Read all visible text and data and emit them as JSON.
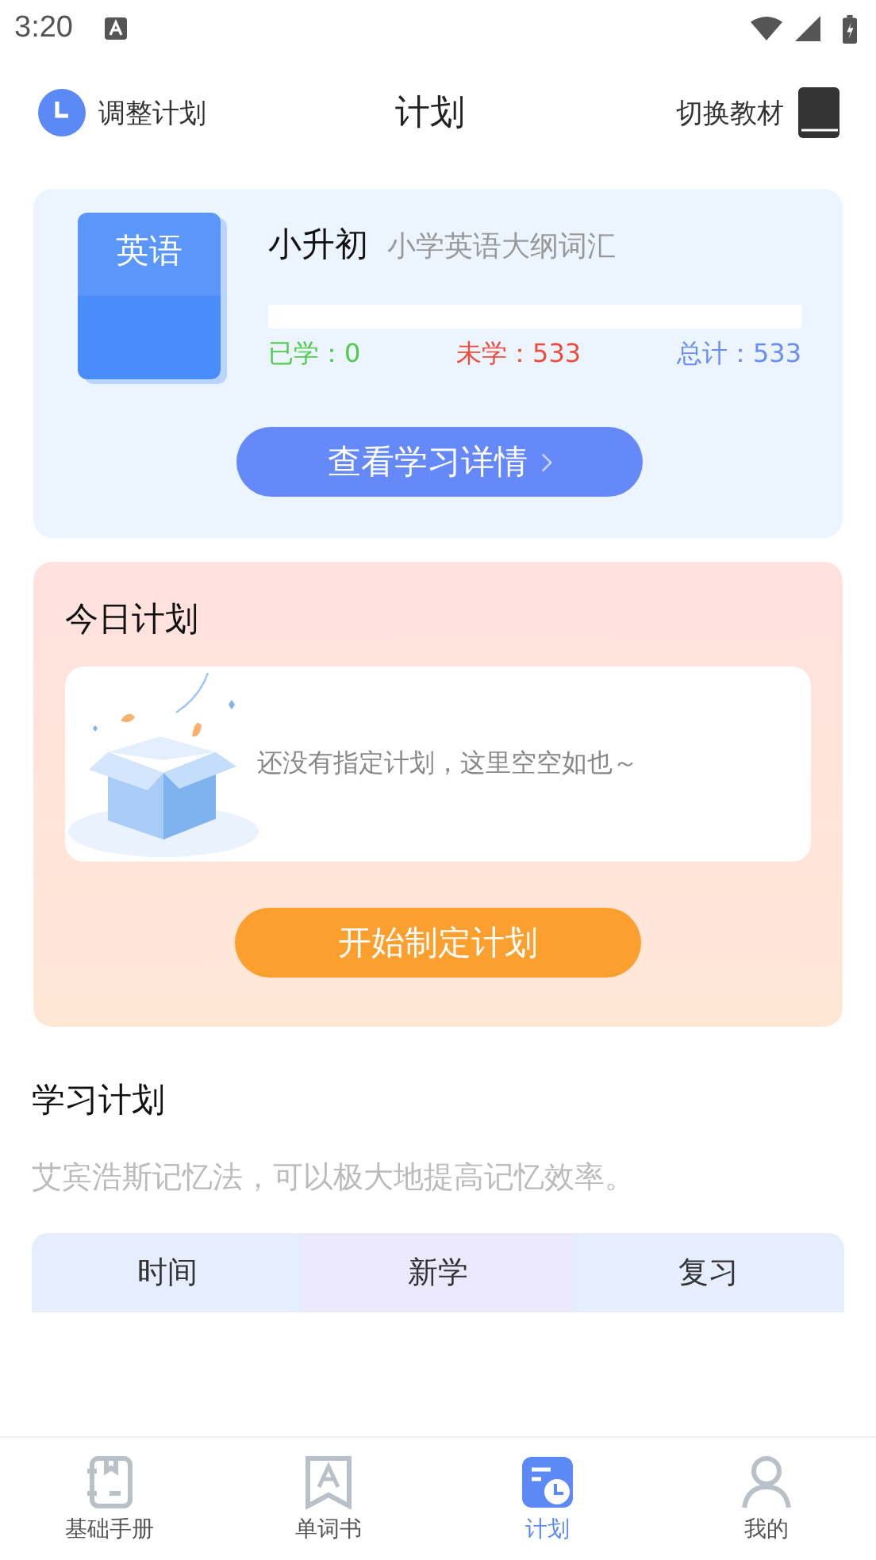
{
  "status_bar": {
    "time": "3:20"
  },
  "header": {
    "left_action": "调整计划",
    "title": "计划",
    "right_action": "切换教材"
  },
  "book_card": {
    "cover_label": "英语",
    "name": "小升初",
    "subtitle": "小学英语大纲词汇",
    "progress": {
      "level": 0
    },
    "stats": [
      {
        "kind": "learned",
        "text": "已学：0"
      },
      {
        "kind": "unlearned",
        "text": "未学：533"
      },
      {
        "kind": "total",
        "text": "总计：533"
      }
    ],
    "button": "查看学习详情"
  },
  "today_plan": {
    "title": "今日计划",
    "empty_text": "还没有指定计划，这里空空如也～",
    "button": "开始制定计划"
  },
  "study_plan": {
    "title": "学习计划",
    "description": "艾宾浩斯记忆法，可以极大地提高记忆效率。",
    "columns": [
      {
        "label": "时间",
        "color": "#e6edfd"
      },
      {
        "label": "新学",
        "color": "#ece9fc"
      },
      {
        "label": "复习",
        "color": "#e6edfd"
      }
    ]
  },
  "tab_bar": [
    {
      "kind": "handbook",
      "label": "基础手册",
      "selected": false
    },
    {
      "kind": "wordbook",
      "label": "单词书",
      "selected": false
    },
    {
      "kind": "plan",
      "label": "计划",
      "selected": true
    },
    {
      "kind": "profile",
      "label": "我的",
      "selected": false
    }
  ]
}
